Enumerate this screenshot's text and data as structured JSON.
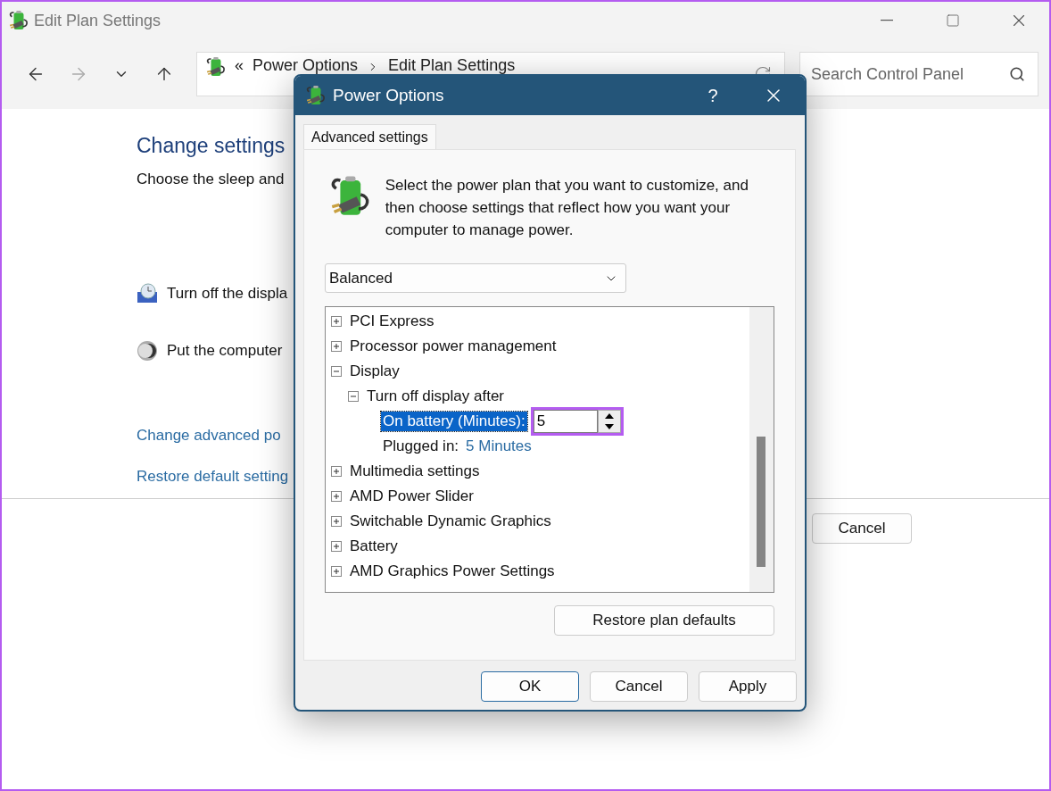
{
  "window": {
    "title": "Edit Plan Settings"
  },
  "nav": {
    "breadcrumb_mark": "«",
    "breadcrumb": [
      "Power Options",
      "Edit Plan Settings"
    ],
    "search": {
      "placeholder": "Search Control Panel"
    }
  },
  "page": {
    "heading": "Change settings",
    "subtitle": "Choose the sleep and",
    "settings": [
      {
        "kind": "display",
        "label": "Turn off the displa"
      },
      {
        "kind": "sleep",
        "label": "Put the computer"
      }
    ],
    "links": [
      "Change advanced po",
      "Restore default setting"
    ],
    "buttons": [
      "Cancel"
    ]
  },
  "dialog": {
    "title": "Power Options",
    "help": "?",
    "tabs": [
      {
        "label": "Advanced settings",
        "selected": true
      }
    ],
    "description": "Select the power plan that you want to customize, and then choose settings that reflect how you want your computer to manage power.",
    "plan": {
      "value": "Balanced"
    },
    "tree": [
      {
        "label": "PCI Express",
        "expanded": false
      },
      {
        "label": "Processor power management",
        "expanded": false
      },
      {
        "label": "Display",
        "expanded": true,
        "children": [
          {
            "label": "Turn off display after",
            "expanded": true,
            "children": [
              {
                "kind": "spinner",
                "label": "On battery (Minutes):",
                "value": "5",
                "selected": true,
                "highlighted": true
              },
              {
                "kind": "value",
                "label": "Plugged in:",
                "value": "5 Minutes",
                "selected": false
              }
            ]
          }
        ]
      },
      {
        "label": "Multimedia settings",
        "expanded": false
      },
      {
        "label": "AMD Power Slider",
        "expanded": false
      },
      {
        "label": "Switchable Dynamic Graphics",
        "expanded": false
      },
      {
        "label": "Battery",
        "expanded": false
      },
      {
        "label": "AMD Graphics Power Settings",
        "expanded": false
      }
    ],
    "restore_button": "Restore plan defaults",
    "buttons": [
      {
        "label": "OK",
        "default": true
      },
      {
        "label": "Cancel",
        "default": false
      },
      {
        "label": "Apply",
        "default": false
      }
    ]
  }
}
